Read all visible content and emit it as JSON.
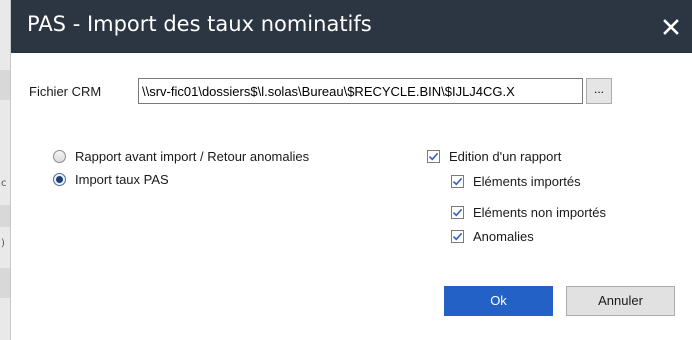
{
  "window": {
    "title": "PAS - Import des taux nominatifs",
    "close_glyph": "✕"
  },
  "file": {
    "label": "Fichier CRM",
    "value": "\\\\srv-fic01\\dossiers$\\l.solas\\Bureau\\$RECYCLE.BIN\\$IJLJ4CG.X",
    "browse_label": "..."
  },
  "mode": {
    "options": [
      {
        "label": "Rapport avant import / Retour anomalies",
        "checked": false
      },
      {
        "label": "Import taux PAS",
        "checked": true
      }
    ]
  },
  "report": {
    "main": {
      "label": "Edition d'un rapport",
      "checked": true
    },
    "items": [
      {
        "label": "Eléments importés",
        "checked": true
      },
      {
        "label": "Eléments non importés",
        "checked": true
      },
      {
        "label": "Anomalies",
        "checked": true
      }
    ]
  },
  "buttons": {
    "ok": "Ok",
    "cancel": "Annuler"
  },
  "background": {
    "marks": [
      "c",
      ")"
    ]
  },
  "colors": {
    "titlebar": "#2c3643",
    "primary_button": "#2461c7",
    "checkmark": "#2f62b8"
  }
}
